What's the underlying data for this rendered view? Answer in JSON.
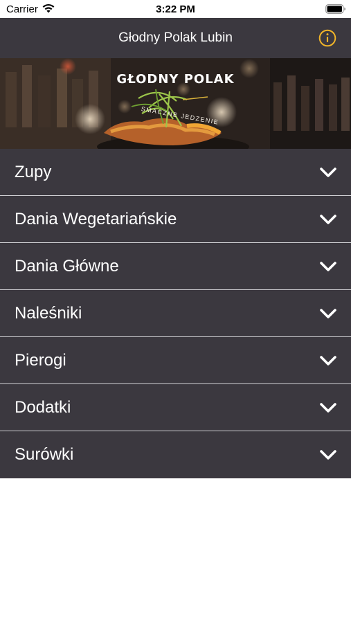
{
  "status_bar": {
    "carrier": "Carrier",
    "time": "3:22 PM"
  },
  "nav": {
    "title": "Głodny Polak Lubin",
    "info_icon": "info-circle-icon",
    "accent_color": "#f0b429"
  },
  "banner": {
    "logo_text": "GŁODNY POLAK",
    "logo_subtitle": "SMACZNE JEDZENIE"
  },
  "menu": {
    "chevron_icon": "chevron-down-icon",
    "items": [
      {
        "label": "Zupy"
      },
      {
        "label": "Dania Wegetariańskie"
      },
      {
        "label": "Dania Główne"
      },
      {
        "label": "Naleśniki"
      },
      {
        "label": "Pierogi"
      },
      {
        "label": "Dodatki"
      },
      {
        "label": "Surówki"
      }
    ]
  },
  "colors": {
    "bar_background": "#3b383f",
    "separator": "#cfcfd3",
    "text": "#ffffff"
  }
}
